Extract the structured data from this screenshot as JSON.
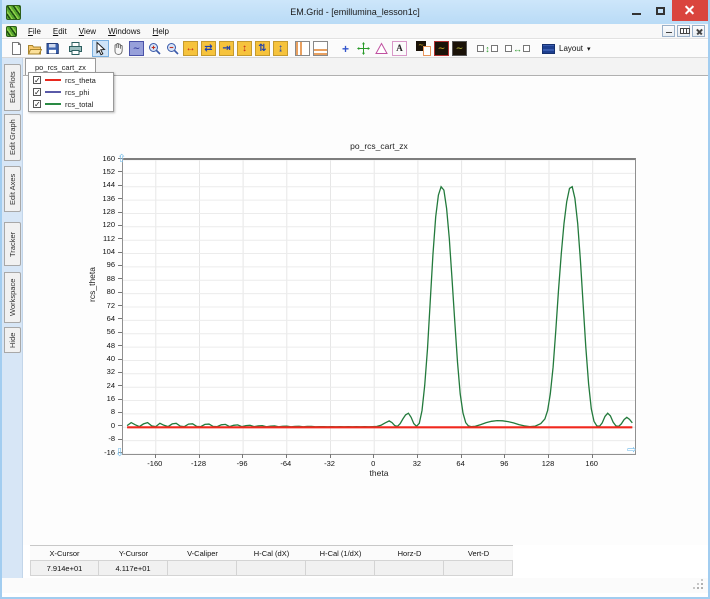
{
  "window": {
    "title": "EM.Grid - [emillumina_lesson1c]"
  },
  "menu": {
    "items": [
      "File",
      "Edit",
      "View",
      "Windows",
      "Help"
    ]
  },
  "toolbar": {
    "layout_label": "Layout",
    "buttons": [
      {
        "name": "new-file"
      },
      {
        "name": "open-file"
      },
      {
        "name": "save-file"
      },
      {
        "name": "print"
      },
      {
        "name": "select-arrow",
        "active": true
      },
      {
        "name": "pan-hand"
      },
      {
        "name": "zoom-window"
      },
      {
        "name": "zoom-in"
      },
      {
        "name": "zoom-out"
      },
      {
        "name": "expand-horizontal"
      },
      {
        "name": "compress-horizontal"
      },
      {
        "name": "fit-horizontal"
      },
      {
        "name": "expand-vertical"
      },
      {
        "name": "compress-vertical"
      },
      {
        "name": "fit-vertical"
      },
      {
        "name": "split-vertical"
      },
      {
        "name": "split-horizontal"
      },
      {
        "name": "cross-marker"
      },
      {
        "name": "tracker-axes"
      },
      {
        "name": "caliper-triangle"
      },
      {
        "name": "text-annotation"
      },
      {
        "name": "graph-settings"
      },
      {
        "name": "graph-view-red"
      },
      {
        "name": "graph-view-dark"
      },
      {
        "name": "distribute-vertical"
      },
      {
        "name": "distribute-horizontal"
      },
      {
        "name": "layout-menu",
        "label": "Layout"
      }
    ]
  },
  "tabs": {
    "active": "po_rcs_cart_zx"
  },
  "sidebar": {
    "tabs": [
      {
        "label": "Edit Plots"
      },
      {
        "label": "Edit Graph"
      },
      {
        "label": "Edit Axes"
      },
      {
        "label": "Tracker"
      },
      {
        "label": "Workspace"
      },
      {
        "label": "Hide"
      }
    ]
  },
  "legend": {
    "items": [
      {
        "label": "rcs_theta",
        "color": "#e8281e",
        "checked": true
      },
      {
        "label": "rcs_phi",
        "color": "#5a5aa8",
        "checked": true
      },
      {
        "label": "rcs_total",
        "color": "#2a8a44",
        "checked": true
      }
    ]
  },
  "chart_data": {
    "type": "line",
    "title": "po_rcs_cart_zx",
    "xlabel": "theta",
    "ylabel": "rcs_theta",
    "xlim": [
      -184,
      191
    ],
    "ylim": [
      -16,
      160
    ],
    "x_ticks": [
      -160,
      -128,
      -96,
      -64,
      -32,
      0,
      32,
      64,
      96,
      128,
      160
    ],
    "y_ticks": [
      160,
      152,
      144,
      136,
      128,
      120,
      112,
      104,
      96,
      88,
      80,
      72,
      64,
      56,
      48,
      40,
      32,
      24,
      16,
      8,
      0,
      -8,
      -16
    ],
    "grid": true,
    "legend_position": "top-left",
    "series": [
      {
        "name": "rcs_phi",
        "color": "#5a5aa8",
        "width": 1,
        "points": [
          [
            -181,
            0
          ],
          [
            189,
            0
          ]
        ]
      },
      {
        "name": "rcs_total",
        "color": "#237a3c",
        "width": 1.3,
        "points": [
          [
            -181,
            1
          ],
          [
            -178,
            2.8
          ],
          [
            -175,
            1.5
          ],
          [
            -172,
            0.4
          ],
          [
            -169,
            2
          ],
          [
            -166,
            2.8
          ],
          [
            -163,
            0.8
          ],
          [
            -160,
            0.4
          ],
          [
            -157,
            2.4
          ],
          [
            -154,
            1.2
          ],
          [
            -151,
            0.4
          ],
          [
            -148,
            2
          ],
          [
            -145,
            2.4
          ],
          [
            -142,
            0.7
          ],
          [
            -139,
            0.4
          ],
          [
            -136,
            1.9
          ],
          [
            -133,
            2.1
          ],
          [
            -130,
            0.5
          ],
          [
            -127,
            0.4
          ],
          [
            -124,
            1.7
          ],
          [
            -121,
            1.9
          ],
          [
            -118,
            0.5
          ],
          [
            -115,
            0.4
          ],
          [
            -112,
            1.5
          ],
          [
            -109,
            1.7
          ],
          [
            -106,
            0.4
          ],
          [
            -103,
            1.2
          ],
          [
            -100,
            1.4
          ],
          [
            -97,
            0.4
          ],
          [
            -94,
            1
          ],
          [
            -91,
            1.2
          ],
          [
            -88,
            0.4
          ],
          [
            -85,
            0.8
          ],
          [
            -82,
            1
          ],
          [
            -79,
            0.3
          ],
          [
            -76,
            0.7
          ],
          [
            -73,
            0.8
          ],
          [
            -70,
            0.3
          ],
          [
            -67,
            0.6
          ],
          [
            -64,
            0.7
          ],
          [
            -61,
            0.3
          ],
          [
            -58,
            0.5
          ],
          [
            -55,
            0.6
          ],
          [
            -52,
            0.3
          ],
          [
            -49,
            0.5
          ],
          [
            -46,
            0.5
          ],
          [
            -43,
            0.3
          ],
          [
            -40,
            0.4
          ],
          [
            -37,
            0.4
          ],
          [
            -34,
            0.3
          ],
          [
            -31,
            0.4
          ],
          [
            -28,
            0.3
          ],
          [
            -25,
            0.4
          ],
          [
            -22,
            0.3
          ],
          [
            -19,
            0.4
          ],
          [
            -16,
            0.3
          ],
          [
            -13,
            0.4
          ],
          [
            -10,
            0.3
          ],
          [
            -7,
            0.4
          ],
          [
            -4,
            0.3
          ],
          [
            -1,
            0.4
          ],
          [
            2,
            0.5
          ],
          [
            5,
            1.2
          ],
          [
            8,
            2.6
          ],
          [
            11,
            3.8
          ],
          [
            13,
            2.8
          ],
          [
            15,
            1
          ],
          [
            17,
            0.5
          ],
          [
            19,
            2.2
          ],
          [
            21,
            5
          ],
          [
            23,
            7.4
          ],
          [
            25,
            8.4
          ],
          [
            27,
            6
          ],
          [
            29,
            2.2
          ],
          [
            31,
            0.6
          ],
          [
            33,
            2.4
          ],
          [
            35,
            10
          ],
          [
            37,
            25
          ],
          [
            39,
            47
          ],
          [
            41,
            75
          ],
          [
            43,
            103
          ],
          [
            45,
            126
          ],
          [
            47,
            139
          ],
          [
            49,
            144
          ],
          [
            51,
            142
          ],
          [
            53,
            131
          ],
          [
            55,
            113
          ],
          [
            57,
            89
          ],
          [
            59,
            63
          ],
          [
            61,
            39
          ],
          [
            63,
            20
          ],
          [
            65,
            8.5
          ],
          [
            67,
            2.8
          ],
          [
            69,
            0.8
          ],
          [
            71,
            0.4
          ],
          [
            74,
            0.6
          ],
          [
            78,
            1.6
          ],
          [
            82,
            2.8
          ],
          [
            86,
            3.6
          ],
          [
            90,
            4
          ],
          [
            94,
            3.9
          ],
          [
            98,
            3.4
          ],
          [
            102,
            2.6
          ],
          [
            106,
            1.6
          ],
          [
            110,
            0.8
          ],
          [
            114,
            0.4
          ],
          [
            118,
            0.7
          ],
          [
            122,
            2.2
          ],
          [
            125,
            5
          ],
          [
            127,
            10
          ],
          [
            129,
            20
          ],
          [
            131,
            36
          ],
          [
            133,
            58
          ],
          [
            135,
            82
          ],
          [
            137,
            104
          ],
          [
            139,
            122
          ],
          [
            141,
            135
          ],
          [
            143,
            143
          ],
          [
            145,
            144
          ],
          [
            147,
            137
          ],
          [
            149,
            122
          ],
          [
            151,
            100
          ],
          [
            153,
            74
          ],
          [
            155,
            48
          ],
          [
            157,
            26
          ],
          [
            159,
            11
          ],
          [
            161,
            3.6
          ],
          [
            163,
            0.8
          ],
          [
            165,
            0.6
          ],
          [
            167,
            2.6
          ],
          [
            169,
            6.5
          ],
          [
            171,
            8.4
          ],
          [
            173,
            6.8
          ],
          [
            175,
            3
          ],
          [
            177,
            0.8
          ],
          [
            179,
            0.5
          ],
          [
            181,
            2
          ],
          [
            183,
            4.6
          ],
          [
            185,
            6
          ],
          [
            187,
            4.8
          ],
          [
            189,
            2.6
          ]
        ]
      },
      {
        "name": "rcs_theta",
        "color": "#f0281e",
        "width": 2.2,
        "points": [
          [
            -181,
            0
          ],
          [
            189,
            0
          ]
        ]
      }
    ]
  },
  "cursor_table": {
    "columns": [
      {
        "label": "X-Cursor",
        "value": "7.914e+01"
      },
      {
        "label": "Y-Cursor",
        "value": "4.117e+01"
      },
      {
        "label": "V-Caliper",
        "value": ""
      },
      {
        "label": "H-Cal (dX)",
        "value": ""
      },
      {
        "label": "H-Cal (1/dX)",
        "value": ""
      },
      {
        "label": "Horz-D",
        "value": ""
      },
      {
        "label": "Vert-D",
        "value": ""
      }
    ]
  }
}
